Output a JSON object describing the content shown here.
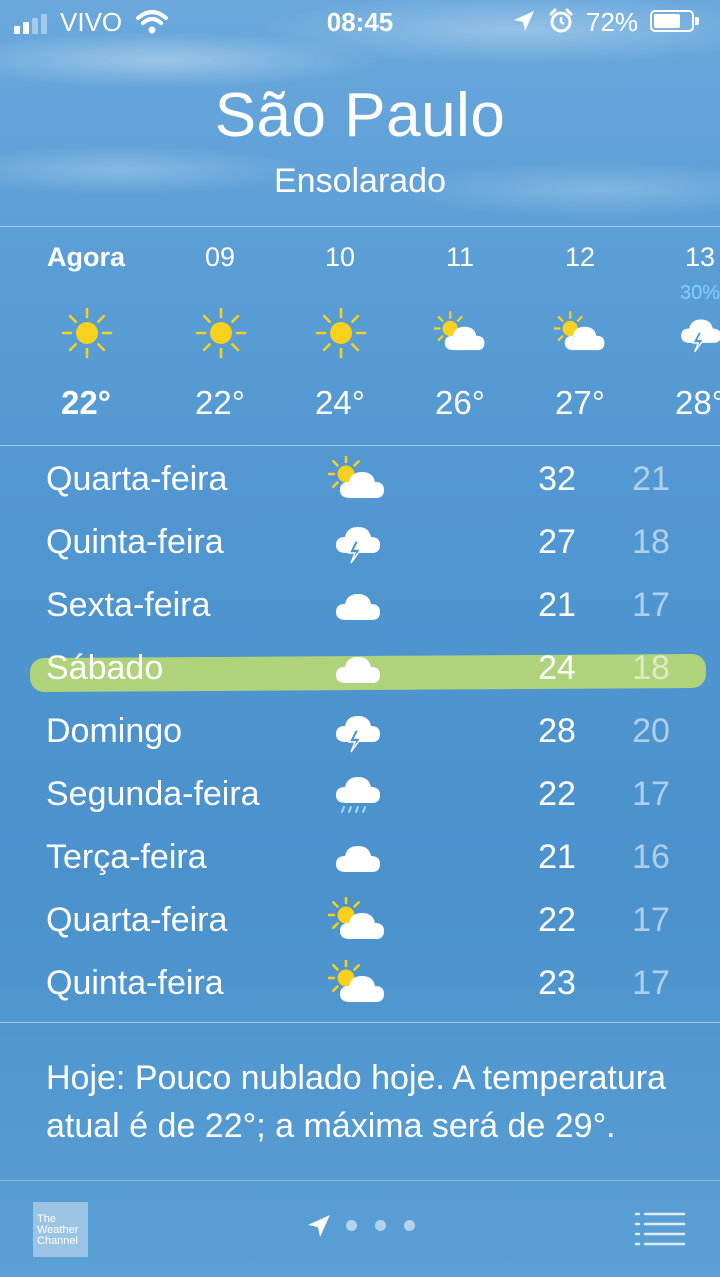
{
  "status": {
    "carrier": "VIVO",
    "time": "08:45",
    "battery": "72%",
    "battery_level": 0.72
  },
  "location": {
    "city": "São Paulo",
    "condition": "Ensolarado"
  },
  "hourly": [
    {
      "label": "Agora",
      "icon": "sun-icon",
      "temp": "22°",
      "prob": ""
    },
    {
      "label": "09",
      "icon": "sun-icon",
      "temp": "22°",
      "prob": ""
    },
    {
      "label": "10",
      "icon": "sun-icon",
      "temp": "24°",
      "prob": ""
    },
    {
      "label": "11",
      "icon": "partly-sunny-icon",
      "temp": "26°",
      "prob": ""
    },
    {
      "label": "12",
      "icon": "partly-sunny-icon",
      "temp": "27°",
      "prob": ""
    },
    {
      "label": "13",
      "icon": "thunderstorm-icon",
      "temp": "28°",
      "prob": "30%"
    }
  ],
  "daily": [
    {
      "day": "Quarta-feira",
      "icon": "partly-sunny-icon",
      "high": "32",
      "low": "21"
    },
    {
      "day": "Quinta-feira",
      "icon": "thunderstorm-icon",
      "high": "27",
      "low": "18"
    },
    {
      "day": "Sexta-feira",
      "icon": "cloud-icon",
      "high": "21",
      "low": "17"
    },
    {
      "day": "Sábado",
      "icon": "cloud-icon",
      "high": "24",
      "low": "18"
    },
    {
      "day": "Domingo",
      "icon": "thunderstorm-icon",
      "high": "28",
      "low": "20"
    },
    {
      "day": "Segunda-feira",
      "icon": "rain-icon",
      "high": "22",
      "low": "17"
    },
    {
      "day": "Terça-feira",
      "icon": "cloud-icon",
      "high": "21",
      "low": "16"
    },
    {
      "day": "Quarta-feira",
      "icon": "partly-sunny-icon",
      "high": "22",
      "low": "17"
    },
    {
      "day": "Quinta-feira",
      "icon": "partly-sunny-icon",
      "high": "23",
      "low": "17"
    }
  ],
  "summary": "Hoje: Pouco nublado hoje. A temperatura atual é de 22°; a máxima será de 29°.",
  "toolbar": {
    "logo": "The Weather Channel",
    "page_count": 3
  },
  "colors": {
    "sky": "#4f95d0",
    "sun": "#f7d11e",
    "highlight": "#d6ec5a",
    "precip": "#7fd1ff"
  }
}
